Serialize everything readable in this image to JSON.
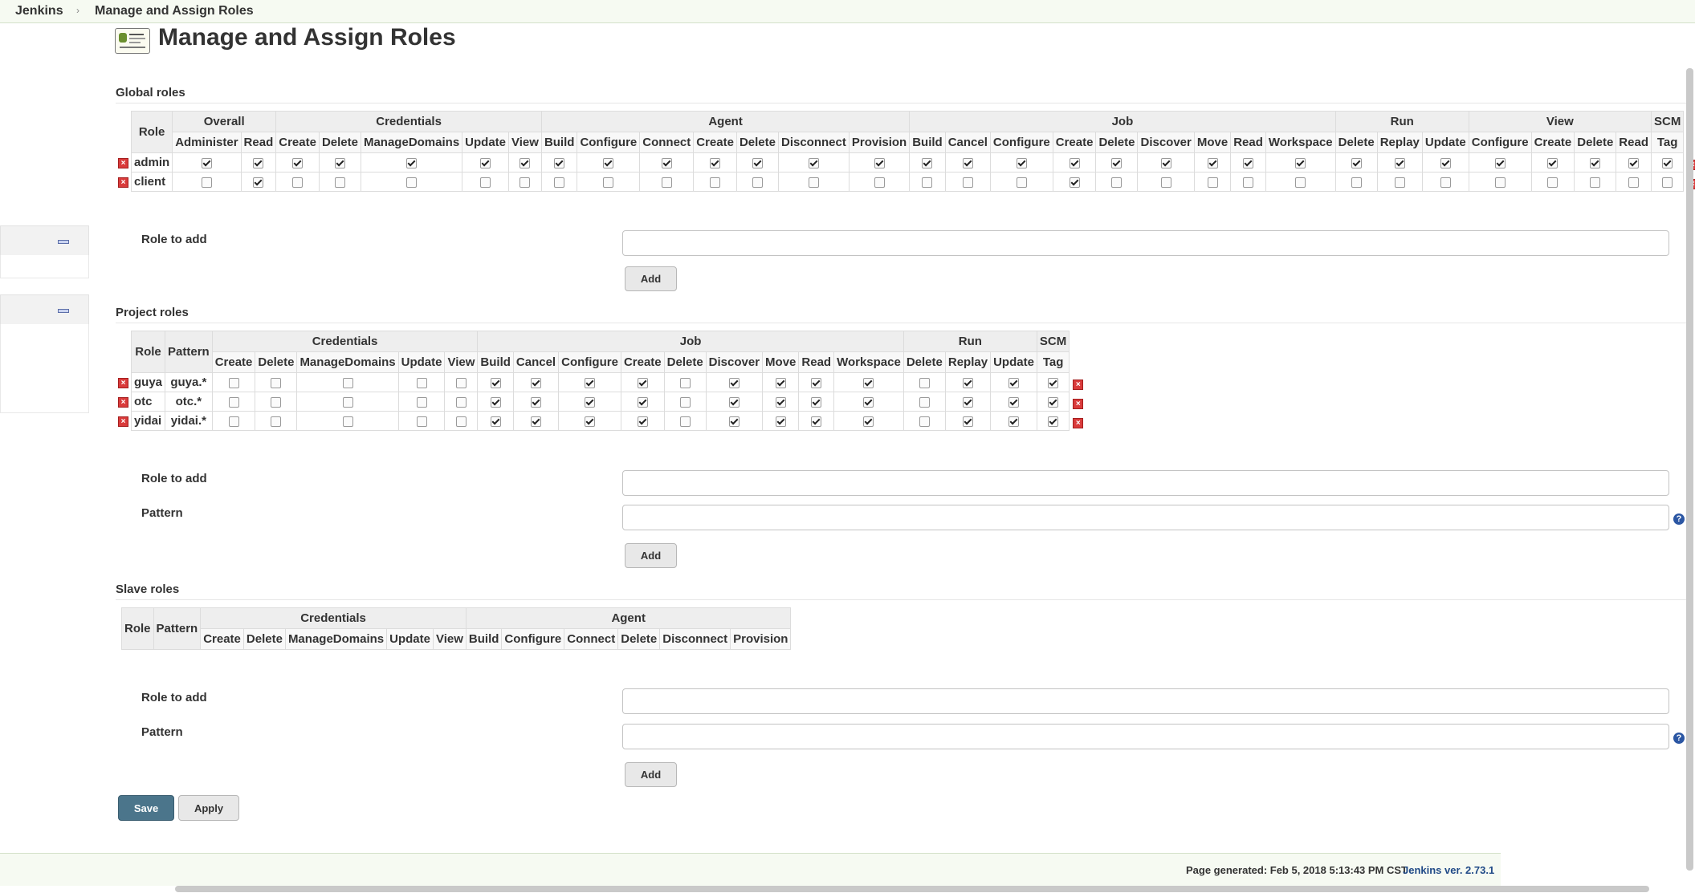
{
  "breadcrumb": {
    "home": "Jenkins",
    "separator": "›",
    "current": "Manage and Assign Roles"
  },
  "page": {
    "title": "Manage and Assign Roles"
  },
  "global": {
    "title": "Global roles",
    "role_header": "Role",
    "groups": [
      {
        "label": "Overall",
        "perms": [
          "Administer",
          "Read"
        ]
      },
      {
        "label": "Credentials",
        "perms": [
          "Create",
          "Delete",
          "ManageDomains",
          "Update",
          "View"
        ]
      },
      {
        "label": "Agent",
        "perms": [
          "Build",
          "Configure",
          "Connect",
          "Create",
          "Delete",
          "Disconnect",
          "Provision"
        ]
      },
      {
        "label": "Job",
        "perms": [
          "Build",
          "Cancel",
          "Configure",
          "Create",
          "Delete",
          "Discover",
          "Move",
          "Read",
          "Workspace"
        ]
      },
      {
        "label": "Run",
        "perms": [
          "Delete",
          "Replay",
          "Update"
        ]
      },
      {
        "label": "View",
        "perms": [
          "Configure",
          "Create",
          "Delete",
          "Read"
        ]
      },
      {
        "label": "SCM",
        "perms": [
          "Tag"
        ]
      }
    ],
    "rows": [
      {
        "role": "admin",
        "checks": [
          1,
          1,
          1,
          1,
          1,
          1,
          1,
          1,
          1,
          1,
          1,
          1,
          1,
          1,
          1,
          1,
          1,
          1,
          1,
          1,
          1,
          1,
          1,
          1,
          1,
          1,
          1,
          1,
          1,
          1,
          1
        ]
      },
      {
        "role": "client",
        "checks": [
          0,
          1,
          0,
          0,
          0,
          0,
          0,
          0,
          0,
          0,
          0,
          0,
          0,
          0,
          0,
          0,
          0,
          1,
          0,
          0,
          0,
          0,
          0,
          0,
          0,
          0,
          0,
          0,
          0,
          0,
          0
        ]
      }
    ],
    "role_to_add_label": "Role to add",
    "add_button": "Add"
  },
  "project": {
    "title": "Project roles",
    "role_header": "Role",
    "pattern_header": "Pattern",
    "groups": [
      {
        "label": "Credentials",
        "perms": [
          "Create",
          "Delete",
          "ManageDomains",
          "Update",
          "View"
        ]
      },
      {
        "label": "Job",
        "perms": [
          "Build",
          "Cancel",
          "Configure",
          "Create",
          "Delete",
          "Discover",
          "Move",
          "Read",
          "Workspace"
        ]
      },
      {
        "label": "Run",
        "perms": [
          "Delete",
          "Replay",
          "Update"
        ]
      },
      {
        "label": "SCM",
        "perms": [
          "Tag"
        ]
      }
    ],
    "rows": [
      {
        "role": "guya",
        "pattern": "guya.*",
        "checks": [
          0,
          0,
          0,
          0,
          0,
          1,
          1,
          1,
          1,
          0,
          1,
          1,
          1,
          1,
          0,
          1,
          1,
          1
        ]
      },
      {
        "role": "otc",
        "pattern": "otc.*",
        "checks": [
          0,
          0,
          0,
          0,
          0,
          1,
          1,
          1,
          1,
          0,
          1,
          1,
          1,
          1,
          0,
          1,
          1,
          1
        ]
      },
      {
        "role": "yidai",
        "pattern": "yidai.*",
        "checks": [
          0,
          0,
          0,
          0,
          0,
          1,
          1,
          1,
          1,
          0,
          1,
          1,
          1,
          1,
          0,
          1,
          1,
          1
        ]
      }
    ],
    "role_to_add_label": "Role to add",
    "pattern_label": "Pattern",
    "add_button": "Add"
  },
  "slave": {
    "title": "Slave roles",
    "role_header": "Role",
    "pattern_header": "Pattern",
    "groups": [
      {
        "label": "Credentials",
        "perms": [
          "Create",
          "Delete",
          "ManageDomains",
          "Update",
          "View"
        ]
      },
      {
        "label": "Agent",
        "perms": [
          "Build",
          "Configure",
          "Connect",
          "Delete",
          "Disconnect",
          "Provision"
        ]
      }
    ],
    "rows": [],
    "role_to_add_label": "Role to add",
    "pattern_label": "Pattern",
    "add_button": "Add"
  },
  "form": {
    "save": "Save",
    "apply": "Apply"
  },
  "icons": {
    "help": "?",
    "delete": "×",
    "collapse": "collapse-icon"
  },
  "footer": {
    "generated": "Page generated: Feb 5, 2018 5:13:43 PM CST",
    "version": "Jenkins ver. 2.73.1"
  },
  "colors": {
    "save_button": "#4b758b",
    "version_link": "#204a87",
    "delete_icon": "#d93b3b"
  }
}
